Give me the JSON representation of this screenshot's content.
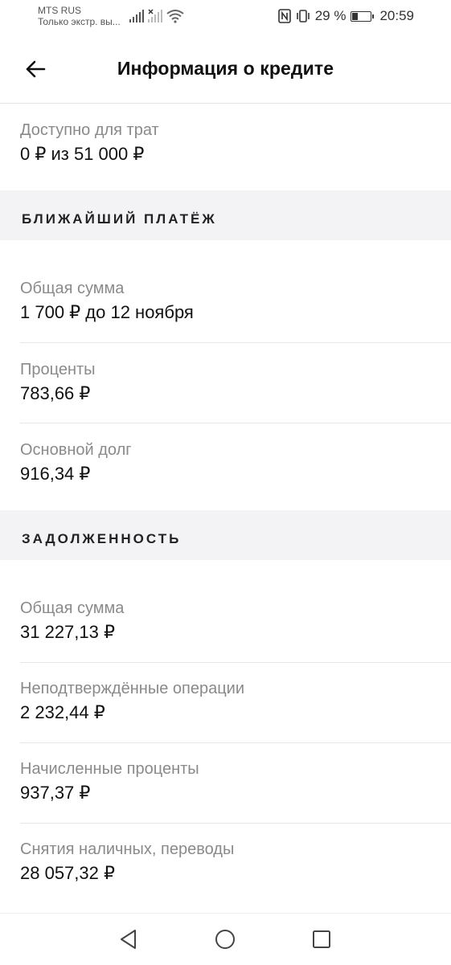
{
  "status_bar": {
    "carrier": "MTS RUS",
    "network_note": "Только экстр. вы...",
    "battery_text": "29 %",
    "battery_level": 0.29,
    "time": "20:59"
  },
  "header": {
    "title": "Информация о кредите"
  },
  "available": {
    "label": "Доступно для трат",
    "value": "0 ₽ из 51 000 ₽"
  },
  "next_payment": {
    "section_title": "БЛИЖАЙШИЙ ПЛАТЁЖ",
    "items": [
      {
        "label": "Общая сумма",
        "value": "1 700 ₽ до 12 ноября"
      },
      {
        "label": "Проценты",
        "value": "783,66 ₽"
      },
      {
        "label": "Основной долг",
        "value": "916,34 ₽"
      }
    ]
  },
  "debt": {
    "section_title": "ЗАДОЛЖЕННОСТЬ",
    "items": [
      {
        "label": "Общая сумма",
        "value": "31 227,13 ₽"
      },
      {
        "label": "Неподтверждённые операции",
        "value": "2 232,44 ₽"
      },
      {
        "label": "Начисленные проценты",
        "value": "937,37 ₽"
      },
      {
        "label": "Снятия наличных, переводы",
        "value": "28 057,32 ₽"
      }
    ]
  },
  "icons": {
    "back": "arrow-left-icon",
    "nav_back": "triangle-back-icon",
    "nav_home": "circle-home-icon",
    "nav_recent": "square-recents-icon"
  }
}
